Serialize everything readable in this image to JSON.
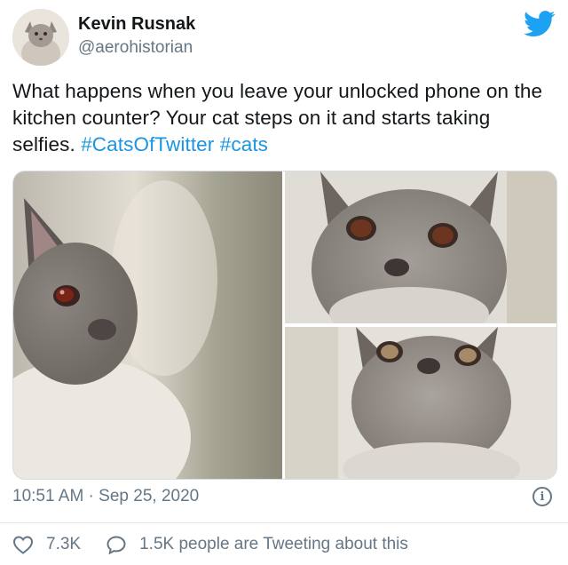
{
  "author": {
    "name": "Kevin Rusnak",
    "handle": "@aerohistorian"
  },
  "tweet": {
    "text": "What happens when you leave your unlocked phone on the kitchen counter? Your cat steps on it and starts taking selfies.",
    "hashtags": [
      "#CatsOfTwitter",
      "#cats"
    ]
  },
  "photos": [
    {
      "subject": "cat-selfie-side"
    },
    {
      "subject": "cat-selfie-front"
    },
    {
      "subject": "cat-selfie-looking-up"
    }
  ],
  "meta": {
    "timestamp": "10:51 AM · Sep 25, 2020",
    "info_glyph": "i"
  },
  "actions": {
    "likes": "7.3K",
    "tweeting": "1.5K people are Tweeting about this"
  },
  "colors": {
    "accent": "#1b95e0",
    "text": "#14171a",
    "secondary": "#657786"
  },
  "icons": [
    "twitter-bird-icon",
    "info-icon",
    "heart-icon",
    "speech-bubble-icon"
  ]
}
